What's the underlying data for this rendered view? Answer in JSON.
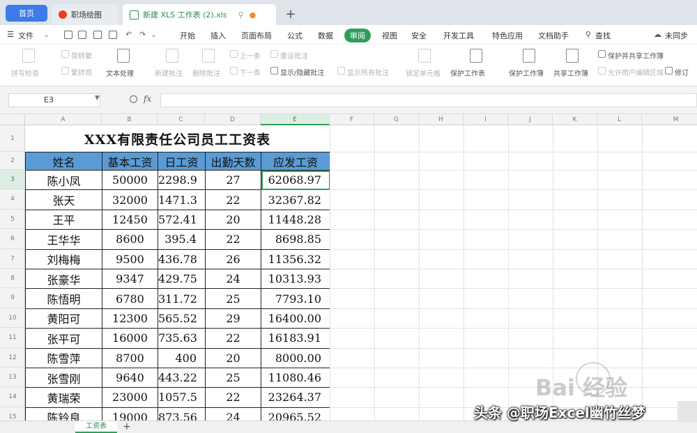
{
  "tabs": {
    "home": "首页",
    "hr": "职场绘图",
    "file": "新建 XLS 工作表 (2).xls"
  },
  "menubar": {
    "file_menu": "文件",
    "items": [
      "开始",
      "插入",
      "页面布局",
      "公式",
      "数据",
      "审阅",
      "视图",
      "安全",
      "开发工具",
      "特色应用",
      "文档助手"
    ],
    "active_item": "审阅",
    "search": "查找",
    "sync": "未同步"
  },
  "ribbon": {
    "spellcheck": "拼写检查",
    "translate": "简转繁",
    "simp": "繁转简",
    "text_process": "文本处理",
    "new_comment": "新建批注",
    "delete_comment": "删除批注",
    "prev": "上一条",
    "next": "下一条",
    "show_hide_comment": "显示/隐藏批注",
    "show_all_comments": "显示所有批注",
    "reset_comment": "重设批注",
    "lock_cell": "锁定单元格",
    "protect_sheet": "保护工作表",
    "protect_workbook": "保护工作簿",
    "share_workbook": "共享工作簿",
    "allow_edit": "保护并共享工作簿",
    "allow_edit_range": "允许用户编辑区域",
    "track": "修订"
  },
  "formula_bar": {
    "cell_ref": "E3",
    "fx": "fx",
    "value": ""
  },
  "columns": [
    "A",
    "B",
    "C",
    "D",
    "E",
    "F",
    "G",
    "H",
    "I",
    "J",
    "K",
    "L",
    "M"
  ],
  "selected_column": "E",
  "rows": [
    "1",
    "2",
    "3",
    "4",
    "5",
    "6",
    "7",
    "8",
    "9",
    "10",
    "11",
    "12",
    "13",
    "14",
    "15"
  ],
  "selected_row": "3",
  "sheet": {
    "title": "XXX有限责任公司员工工资表",
    "headers": [
      "姓名",
      "基本工资",
      "日工资",
      "出勤天数",
      "应发工资"
    ],
    "data": [
      [
        "陈小凤",
        "50000",
        "2298.9",
        "27",
        "62068.97"
      ],
      [
        "张天",
        "32000",
        "1471.3",
        "22",
        "32367.82"
      ],
      [
        "王平",
        "12450",
        "572.41",
        "20",
        "11448.28"
      ],
      [
        "王华华",
        "8600",
        "395.4",
        "22",
        "8698.85"
      ],
      [
        "刘梅梅",
        "9500",
        "436.78",
        "26",
        "11356.32"
      ],
      [
        "张豪华",
        "9347",
        "429.75",
        "24",
        "10313.93"
      ],
      [
        "陈悟明",
        "6780",
        "311.72",
        "25",
        "7793.10"
      ],
      [
        "黄阳可",
        "12300",
        "565.52",
        "29",
        "16400.00"
      ],
      [
        "张平可",
        "16000",
        "735.63",
        "22",
        "16183.91"
      ],
      [
        "陈雪萍",
        "8700",
        "400",
        "20",
        "8000.00"
      ],
      [
        "张雪刚",
        "9640",
        "443.22",
        "25",
        "11080.46"
      ],
      [
        "黄瑞荣",
        "23000",
        "1057.5",
        "22",
        "23264.37"
      ],
      [
        "陈铃良",
        "19000",
        "873.56",
        "24",
        "20965.52"
      ]
    ]
  },
  "sheet_tab": "工资表",
  "watermarks": {
    "toutiao": "头条 @职场Excel幽竹丝梦",
    "baidu": "Bai 经验"
  },
  "colors": {
    "accent": "#2f9e5a",
    "header_fill": "#5b9bd5",
    "tab_home": "#3c7be8"
  }
}
